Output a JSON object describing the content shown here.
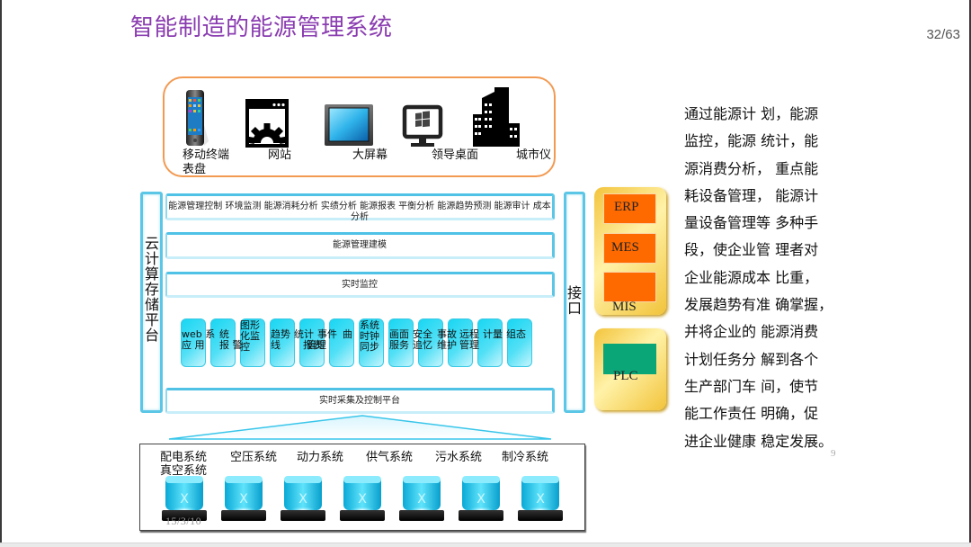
{
  "slide": {
    "title": "智能制造的能源管理系统",
    "page_indicator": "32/63",
    "footer_date": "15/3/10",
    "small_page_number": "9"
  },
  "devices": [
    {
      "label": "移动终端",
      "label2": "表盘",
      "icon": "smartphone-icon"
    },
    {
      "label": "网站",
      "icon": "website-gear-icon"
    },
    {
      "label": "大屏幕",
      "icon": "large-screen-icon"
    },
    {
      "label": "领导桌面",
      "icon": "desktop-monitor-icon"
    },
    {
      "label": "城市仪",
      "icon": "city-buildings-icon"
    }
  ],
  "platform": {
    "cloud_label": "云计算存储平台",
    "interface_label": "接口",
    "layers": {
      "analysis": "能源管理控制 环境监测 能源消耗分析 实绩分析 能源报表 平衡分析 能源趋势预测 能源审计 成本分析",
      "modeling": "能源管理建模",
      "monitoring": "实时监控",
      "acquisition": "实时采集及控制平台"
    },
    "modules": [
      {
        "line1": "web 系",
        "line2": "应 用"
      },
      {
        "line1": "统",
        "line2": "报 警"
      },
      {
        "line1": "图形",
        "line2": "化监",
        "line3": "控"
      },
      {
        "line1": "趋势",
        "line2": "线"
      },
      {
        "line1": "统计",
        "line2": "报表"
      },
      {
        "line1": "事件",
        "line2": "管理"
      },
      {
        "line1": "曲",
        "line2": ""
      },
      {
        "line1": "系统",
        "line2": "时钟",
        "line3": "同步"
      },
      {
        "line1": "画面",
        "line2": "服务"
      },
      {
        "line1": "安全",
        "line2": "追忆"
      },
      {
        "line1": "事故",
        "line2": "维护"
      },
      {
        "line1": "远程",
        "line2": "管理"
      },
      {
        "line1": "计量",
        "line2": ""
      },
      {
        "line1": "组态",
        "line2": ""
      }
    ]
  },
  "external_systems": {
    "upper": [
      "ERP",
      "MES",
      "MIS"
    ],
    "lower": [
      "PLC"
    ],
    "colors": {
      "orange": "#ff6a00",
      "green": "#0aa678",
      "gold": "#f3c43c"
    }
  },
  "description_lines": [
    "通过能源计 划，能源",
    "监控，能源 统计，能",
    "源消费分析， 重点能",
    "耗设备管理， 能源计",
    "量设备管理等 多种手",
    "段，使企业管 理者对",
    "企业能源成本 比重，",
    "发展趋势有准 确掌握，",
    "并将企业的 能源消费",
    "计划任务分 解到各个",
    "生产部门车 间，使节",
    "能工作责任 明确，促",
    "进企业健康 稳定发展。"
  ],
  "field_systems": [
    {
      "label": "配电系统",
      "label2": "真空系统"
    },
    {
      "label": "空压系统"
    },
    {
      "label": "动力系统"
    },
    {
      "label": "供气系统"
    },
    {
      "label": "污水系统"
    },
    {
      "label": "制冷系统"
    }
  ],
  "colors": {
    "title": "#8a3cb0",
    "panel_border": "#f29a52",
    "cyan_border": "#5cc6e6",
    "module_fill": "#18d6f2"
  }
}
